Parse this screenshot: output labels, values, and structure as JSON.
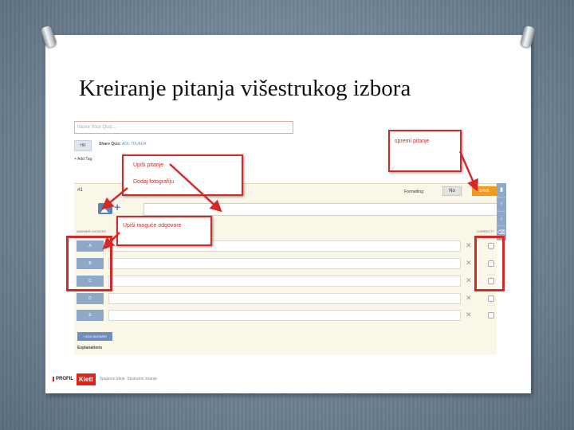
{
  "slide": {
    "title": "Kreiranje pitanja višestrukog izbora"
  },
  "quiz": {
    "name_placeholder": "Name Your Quiz...",
    "flag_label": "HR",
    "share_label": "Share Quiz:",
    "share_code": "ADL 7DU4U4",
    "add_tag": "+ Add Tag",
    "question_number": "#1",
    "formatting_label": "Formatting:",
    "formatting_value": "No",
    "save_label": "SAVE",
    "answer_choices_header": "ANSWER CHOICES",
    "correct_header": "CORRECT?",
    "answers": [
      {
        "letter": "A"
      },
      {
        "letter": "B"
      },
      {
        "letter": "C"
      },
      {
        "letter": "D"
      },
      {
        "letter": "E"
      }
    ],
    "add_answer": "+ ADD ANSWER",
    "explanations": "Explanations"
  },
  "callouts": {
    "save_question": "spremi pitanje",
    "write_question": "Upiši pitanje",
    "add_photo": "Dodaj fotografiju",
    "write_answers": "Upiši moguće odgovore"
  },
  "footer": {
    "profil": "PROFIL",
    "klett": "Klett",
    "slogan": "Spajamo ideje. Stvaramo znanje."
  },
  "colors": {
    "accent_red": "#d72828",
    "save_orange": "#f39a1e",
    "answer_blue": "#8fa8c8"
  }
}
